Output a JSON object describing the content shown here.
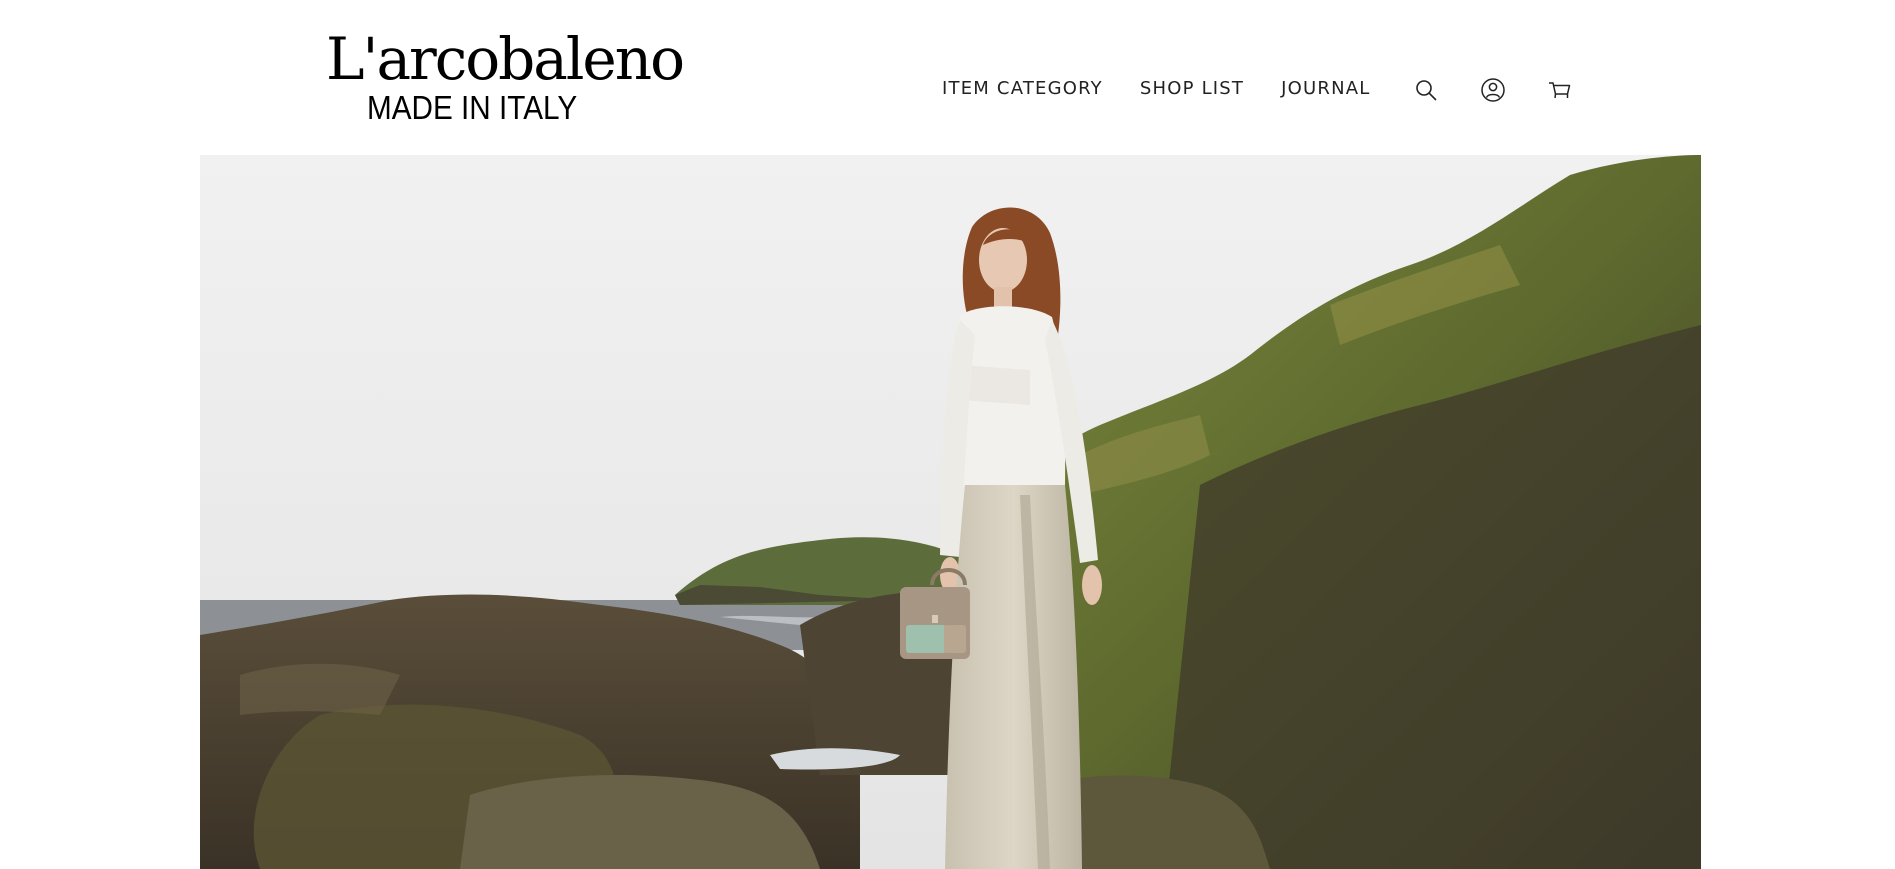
{
  "brand": {
    "wordmark": "L'arcobaleno",
    "tagline": "MADE IN ITALY"
  },
  "nav": {
    "items": [
      {
        "label": "ITEM CATEGORY"
      },
      {
        "label": "SHOP LIST"
      },
      {
        "label": "JOURNAL"
      }
    ]
  },
  "header_icons": [
    "search-icon",
    "account-icon",
    "cart-icon"
  ],
  "hero": {
    "media": "photo-model-walking-on-coastal-rocks"
  },
  "colors": {
    "background": "#ffffff",
    "text": "#1a1a1a",
    "sky": "#ececec"
  }
}
